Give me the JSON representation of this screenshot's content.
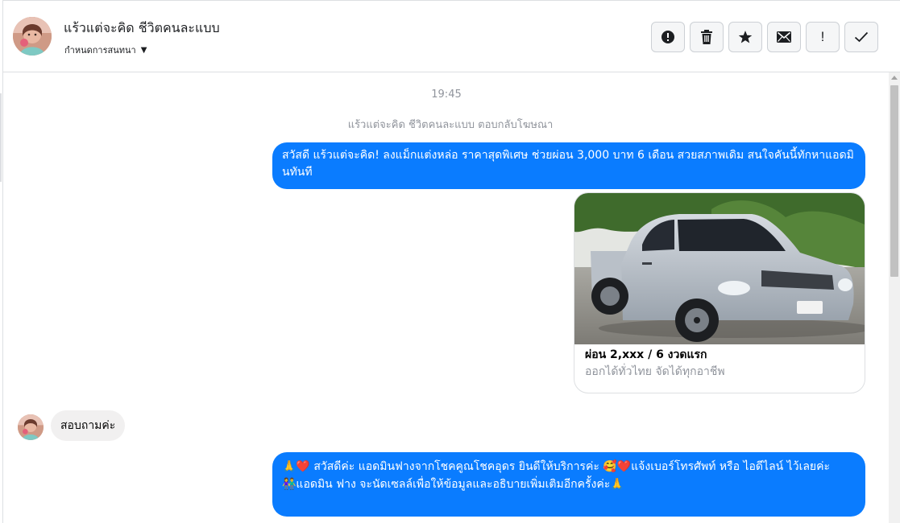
{
  "header": {
    "contact_name": "แร้วแต่จะคิด ชีวิตคนละแบบ",
    "subtitle": "กำหนดการสนทนา"
  },
  "toolbar": {
    "buttons": [
      {
        "icon": "alert-circle-icon"
      },
      {
        "icon": "trash-icon"
      },
      {
        "icon": "star-icon"
      },
      {
        "icon": "mail-icon"
      },
      {
        "icon": "exclamation-icon",
        "label": "!"
      },
      {
        "icon": "check-icon"
      }
    ]
  },
  "thread": {
    "timestamp": "19:45",
    "context": "แร้วแต่จะคิด ชีวิตคนละแบบ ตอบกลับโฆษณา",
    "messages": [
      {
        "from": "page",
        "text": "สวัสดี แร้วแต่จะคิด! ลงแม็กแต่งหล่อ ราคาสุดพิเศษ ช่วยผ่อน 3,000 บาท 6 เดือน สวยสภาพเดิม สนใจคันนี้ทักหาแอดมินทันที"
      },
      {
        "from": "page",
        "type": "card",
        "title": "ผ่อน 2,xxx / 6 งวดแรก",
        "description": "ออกได้ทั่วไทย จัดได้ทุกอาชีพ"
      },
      {
        "from": "user",
        "text": "สอบถามค่ะ"
      },
      {
        "from": "page",
        "line1": "🙏❤️ สวัสดีค่ะ แอดมินฟางจากโชคคูณโชคอุดร ยินดีให้บริการค่ะ 🥰❤️แจ้งเบอร์โทรศัพท์ หรือ ไอดีไลน์  ไว้เลยค่ะ",
        "line2": "👫แอดมิน ฟาง จะนัดเซลล์เพื่อให้ข้อมูลและอธิบายเพิ่มเติมอีกครั้งค่ะ🙏"
      }
    ]
  },
  "colors": {
    "accent": "#0a7cff",
    "incoming_bubble": "#f1f0f0",
    "meta_text": "#90949c",
    "border": "#dddfe2"
  }
}
